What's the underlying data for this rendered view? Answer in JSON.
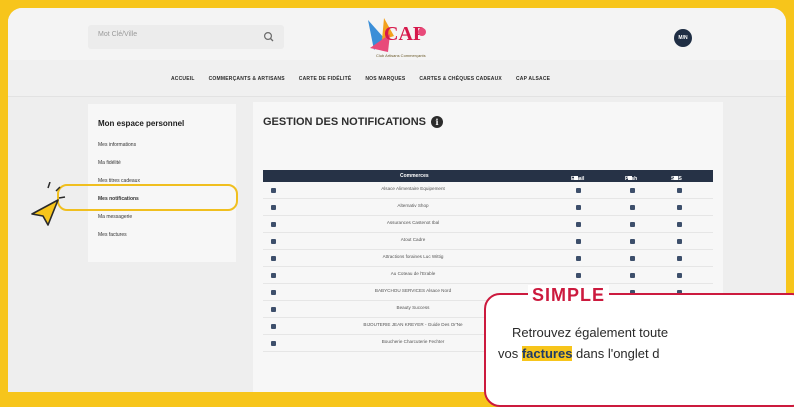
{
  "header": {
    "search_placeholder": "Mot Clé/Ville",
    "logo_text": "CAP",
    "logo_tagline": "Club Artisans Commerçants",
    "avatar_initials": "M/N"
  },
  "nav": {
    "items": [
      "ACCUEIL",
      "COMMERÇANTS & ARTISANS",
      "CARTE DE FIDÉLITÉ",
      "NOS MARQUES",
      "CARTES & CHÈQUES CADEAUX",
      "CAP ALSACE"
    ]
  },
  "sidebar": {
    "title": "Mon espace personnel",
    "items": [
      "Mes informations",
      "Ma fidélité",
      "Mes titres cadeaux",
      "Mes notifications",
      "Ma messagerie",
      "Mes factures"
    ]
  },
  "content": {
    "title": "GESTION DES NOTIFICATIONS",
    "info_icon": "i",
    "columns": [
      "Commerces",
      "Email",
      "Push",
      "SMS"
    ],
    "rows": [
      "Alsace Alimentaire Equipement",
      "Alternativ Shop",
      "Assurances Castenot Ibal",
      "Atout Cadre",
      "Attractions foraines Luc Wittig",
      "Au Coteau de l'Erable",
      "BABYCHOU SERVICES Alsace Nord",
      "Beauty Success",
      "BIJOUTERIE JEAN KREYER - Guide Des Or'Ne",
      "Boucherie Charcuterie Fechter"
    ]
  },
  "callout": {
    "title": "SIMPLE",
    "line1": "Retrouvez également toute",
    "line2_before": "vos ",
    "line2_keyword": "factures",
    "line2_after": " dans l'onglet d"
  },
  "colors": {
    "brand_yellow": "#f7c51b",
    "accent_red": "#cc1a3e",
    "navy": "#263246"
  }
}
